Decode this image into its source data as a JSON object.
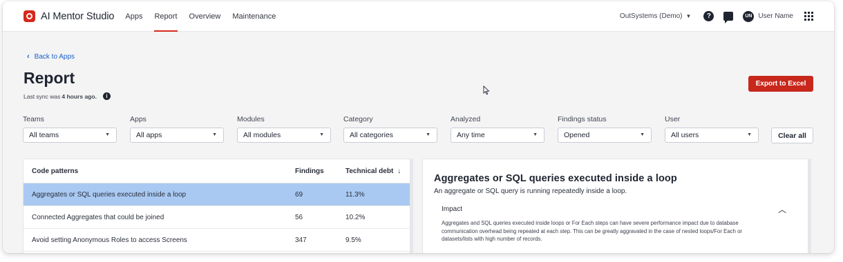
{
  "nav": {
    "brand": "AI Mentor Studio",
    "items": [
      "Apps",
      "Report",
      "Overview",
      "Maintenance"
    ],
    "active": "Report",
    "tenant": "OutSystems (Demo)",
    "avatar_initials": "UN",
    "user_name": "User Name"
  },
  "header": {
    "back_label": "Back to Apps",
    "title": "Report",
    "sync_prefix": "Last sync was",
    "sync_value": "4 hours ago.",
    "export_label": "Export to Excel"
  },
  "filters": [
    {
      "label": "Teams",
      "value": "All teams"
    },
    {
      "label": "Apps",
      "value": "All apps"
    },
    {
      "label": "Modules",
      "value": "All modules"
    },
    {
      "label": "Category",
      "value": "All categories"
    },
    {
      "label": "Analyzed",
      "value": "Any time"
    },
    {
      "label": "Findings status",
      "value": "Opened"
    },
    {
      "label": "User",
      "value": "All users"
    }
  ],
  "clear_label": "Clear all",
  "table": {
    "columns": [
      "Code patterns",
      "Findings",
      "Technical debt"
    ],
    "rows": [
      {
        "pattern": "Aggregates or SQL queries executed inside a loop",
        "findings": "69",
        "debt": "11.3%"
      },
      {
        "pattern": "Connected Aggregates that could be joined",
        "findings": "56",
        "debt": "10.2%"
      },
      {
        "pattern": "Avoid setting Anonymous Roles to access Screens",
        "findings": "347",
        "debt": "9.5%"
      }
    ]
  },
  "detail": {
    "title": "Aggregates or SQL queries executed inside a loop",
    "subtitle": "An aggregate or SQL query is running repeatedly inside a loop.",
    "impact_label": "Impact",
    "impact_lines": [
      "Aggregates and SQL queries executed inside loops or For Each steps can have severe performance impact due to database",
      "communication overhead being repeated at each step. This can be greatly aggravated in the case of nested loops/For Each or",
      "datasets/lists with high number of records."
    ]
  },
  "colors": {
    "accent": "#d6281c",
    "selected_row": "#a9c9f2",
    "link": "#1a5fc8"
  }
}
